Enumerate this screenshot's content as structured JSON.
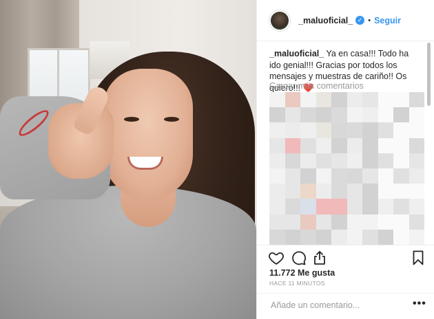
{
  "post": {
    "username": "_maluoficial_",
    "verified_glyph": "✓",
    "separator": "•",
    "follow_label": "Seguir",
    "caption": {
      "username": "_maluoficial_",
      "text": " Ya en casa!!! Todo ha ido genial!!! Gracias por todos los mensajes y muestras de cariño!! Os quiero!!! ",
      "emoji": "❤️"
    },
    "load_more_label": "Cargar más comentarios",
    "likes_text": "11.772 Me gusta",
    "timestamp": "HACE 11 MINUTOS",
    "comment_placeholder": "Añade un comentario...",
    "more_glyph": "•••"
  },
  "icons": {
    "like": "heart-outline-icon",
    "comment": "speech-bubble-icon",
    "share": "share-icon",
    "save": "bookmark-icon"
  },
  "colors": {
    "link_blue": "#3897f0",
    "text": "#262626",
    "muted": "#999999",
    "heart_red": "#e8263c",
    "border": "#efefef"
  }
}
